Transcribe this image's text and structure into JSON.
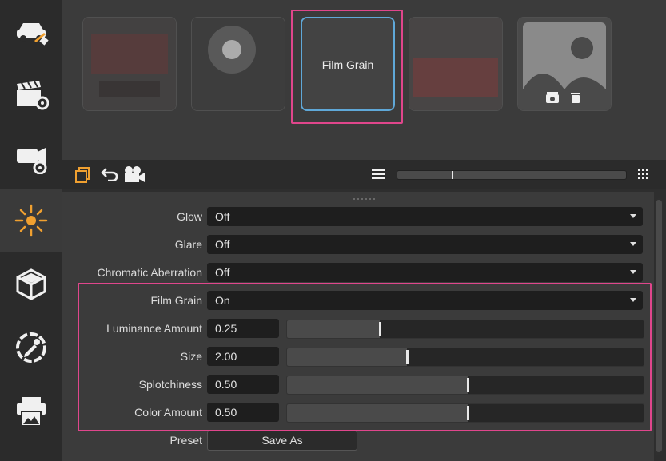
{
  "sidebar": {
    "items": [
      {
        "icon": "car-material-icon"
      },
      {
        "icon": "clapper-settings-icon"
      },
      {
        "icon": "camera-settings-icon"
      },
      {
        "icon": "sun-light-icon"
      },
      {
        "icon": "cube-icon"
      },
      {
        "icon": "color-picker-icon"
      },
      {
        "icon": "printer-icon"
      }
    ]
  },
  "presets": [
    {
      "label": ""
    },
    {
      "label": ""
    },
    {
      "label": "Film Grain"
    },
    {
      "label": ""
    },
    {
      "label": ""
    }
  ],
  "toolbar": {
    "icons": [
      "copy-icon",
      "undo-icon",
      "camera-icon",
      "menu-icon",
      "grid-icon"
    ]
  },
  "settings": {
    "glow": {
      "label": "Glow",
      "value": "Off"
    },
    "glare": {
      "label": "Glare",
      "value": "Off"
    },
    "chromatic": {
      "label": "Chromatic Aberration",
      "value": "Off"
    },
    "film_grain": {
      "label": "Film Grain",
      "value": "On"
    },
    "luminance": {
      "label": "Luminance Amount",
      "value": "0.25",
      "level": 0.26
    },
    "size": {
      "label": "Size",
      "value": "2.00",
      "level": 0.336
    },
    "splotchiness": {
      "label": "Splotchiness",
      "value": "0.50",
      "level": 0.507
    },
    "color_amount": {
      "label": "Color Amount",
      "value": "0.50",
      "level": 0.507
    },
    "preset": {
      "label": "Preset",
      "button": "Save As"
    }
  },
  "colors": {
    "accent": "#f0a030",
    "highlight": "#e0468c",
    "selection": "#5fa8d8"
  }
}
